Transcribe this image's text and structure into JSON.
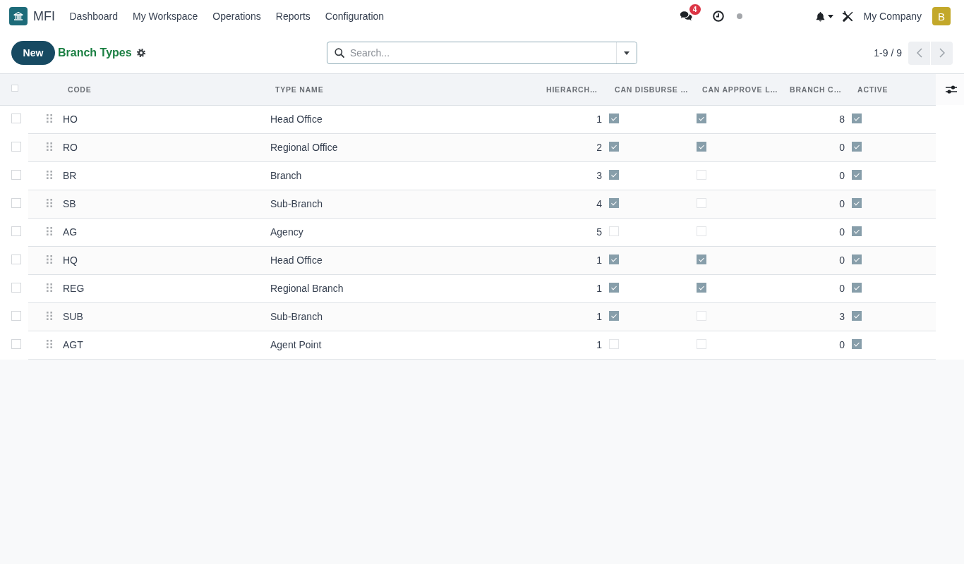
{
  "navbar": {
    "app_name": "MFI",
    "menu": [
      "Dashboard",
      "My Workspace",
      "Operations",
      "Reports",
      "Configuration"
    ],
    "messages_badge": "4",
    "company": "My Company",
    "avatar_letter": "B"
  },
  "control_panel": {
    "new_button": "New",
    "breadcrumb": "Branch Types",
    "search": {
      "placeholder": "Search..."
    },
    "pager": "1-9 / 9"
  },
  "table": {
    "select_all": {
      "checked": false
    },
    "columns": [
      {
        "label": "CODE",
        "kind": "text"
      },
      {
        "label": "TYPE NAME",
        "kind": "text"
      },
      {
        "label": "HIERARCH…",
        "kind": "number"
      },
      {
        "label": "CAN DISBURSE …",
        "kind": "boolean"
      },
      {
        "label": "CAN APPROVE L…",
        "kind": "boolean"
      },
      {
        "label": "BRANCH C…",
        "kind": "number"
      },
      {
        "label": "ACTIVE",
        "kind": "boolean"
      }
    ],
    "rows": [
      {
        "selected": false,
        "cells": [
          {
            "text": "HO"
          },
          {
            "text": "Head Office"
          },
          {
            "text": "1"
          },
          {
            "checked": true
          },
          {
            "checked": true
          },
          {
            "text": "8"
          },
          {
            "checked": true
          }
        ]
      },
      {
        "selected": false,
        "cells": [
          {
            "text": "RO"
          },
          {
            "text": "Regional Office"
          },
          {
            "text": "2"
          },
          {
            "checked": true
          },
          {
            "checked": true
          },
          {
            "text": "0"
          },
          {
            "checked": true
          }
        ]
      },
      {
        "selected": false,
        "cells": [
          {
            "text": "BR"
          },
          {
            "text": "Branch"
          },
          {
            "text": "3"
          },
          {
            "checked": true
          },
          {
            "checked": false
          },
          {
            "text": "0"
          },
          {
            "checked": true
          }
        ]
      },
      {
        "selected": false,
        "cells": [
          {
            "text": "SB"
          },
          {
            "text": "Sub-Branch"
          },
          {
            "text": "4"
          },
          {
            "checked": true
          },
          {
            "checked": false
          },
          {
            "text": "0"
          },
          {
            "checked": true
          }
        ]
      },
      {
        "selected": false,
        "cells": [
          {
            "text": "AG"
          },
          {
            "text": "Agency"
          },
          {
            "text": "5"
          },
          {
            "checked": false
          },
          {
            "checked": false
          },
          {
            "text": "0"
          },
          {
            "checked": true
          }
        ]
      },
      {
        "selected": false,
        "cells": [
          {
            "text": "HQ"
          },
          {
            "text": "Head Office"
          },
          {
            "text": "1"
          },
          {
            "checked": true
          },
          {
            "checked": true
          },
          {
            "text": "0"
          },
          {
            "checked": true
          }
        ]
      },
      {
        "selected": false,
        "cells": [
          {
            "text": "REG"
          },
          {
            "text": "Regional Branch"
          },
          {
            "text": "1"
          },
          {
            "checked": true
          },
          {
            "checked": true
          },
          {
            "text": "0"
          },
          {
            "checked": true
          }
        ]
      },
      {
        "selected": false,
        "cells": [
          {
            "text": "SUB"
          },
          {
            "text": "Sub-Branch"
          },
          {
            "text": "1"
          },
          {
            "checked": true
          },
          {
            "checked": false
          },
          {
            "text": "3"
          },
          {
            "checked": true
          }
        ]
      },
      {
        "selected": false,
        "cells": [
          {
            "text": "AGT"
          },
          {
            "text": "Agent Point"
          },
          {
            "text": "1"
          },
          {
            "checked": false
          },
          {
            "checked": false
          },
          {
            "text": "0"
          },
          {
            "checked": true
          }
        ]
      }
    ]
  }
}
